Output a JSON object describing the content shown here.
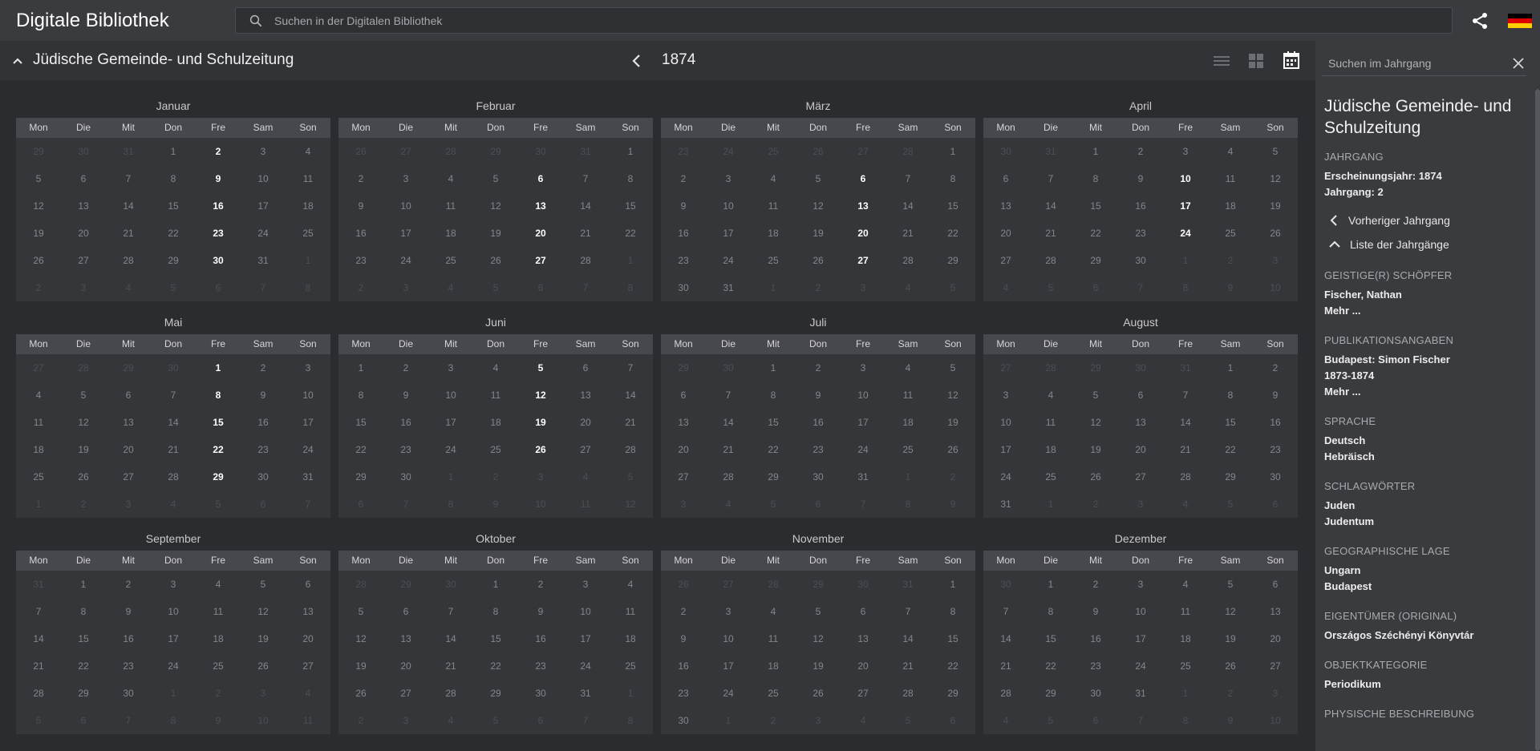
{
  "app": {
    "title": "Digitale Bibliothek",
    "search_placeholder": "Suchen in der Digitalen Bibliothek"
  },
  "header": {
    "issue_title": "Jüdische Gemeinde- und Schulzeitung",
    "year": "1874"
  },
  "weekdays": [
    "Mon",
    "Die",
    "Mit",
    "Don",
    "Fre",
    "Sam",
    "Son"
  ],
  "months": [
    {
      "name": "Januar",
      "lead": [
        29,
        30,
        31
      ],
      "days": 31,
      "issues": [
        2,
        9,
        16,
        23,
        30
      ]
    },
    {
      "name": "Februar",
      "lead": [
        26,
        27,
        28,
        29,
        30,
        31
      ],
      "days": 28,
      "issues": [
        6,
        13,
        20,
        27
      ]
    },
    {
      "name": "März",
      "lead": [
        23,
        24,
        25,
        26,
        27,
        28
      ],
      "days": 31,
      "issues": [
        6,
        13,
        20,
        27
      ]
    },
    {
      "name": "April",
      "lead": [
        30,
        31
      ],
      "days": 30,
      "issues": [
        10,
        17,
        24
      ]
    },
    {
      "name": "Mai",
      "lead": [
        27,
        28,
        29,
        30
      ],
      "days": 31,
      "issues": [
        1,
        8,
        15,
        22,
        29
      ]
    },
    {
      "name": "Juni",
      "lead": [],
      "days": 30,
      "issues": [
        5,
        12,
        19,
        26
      ]
    },
    {
      "name": "Juli",
      "lead": [
        29,
        30
      ],
      "days": 31,
      "issues": []
    },
    {
      "name": "August",
      "lead": [
        27,
        28,
        29,
        30,
        31
      ],
      "days": 31,
      "issues": []
    },
    {
      "name": "September",
      "lead": [
        31
      ],
      "days": 30,
      "issues": []
    },
    {
      "name": "Oktober",
      "lead": [
        28,
        29,
        30
      ],
      "days": 31,
      "issues": []
    },
    {
      "name": "November",
      "lead": [
        26,
        27,
        28,
        29,
        30,
        31
      ],
      "days": 30,
      "issues": []
    },
    {
      "name": "Dezember",
      "lead": [
        30
      ],
      "days": 31,
      "issues": []
    }
  ],
  "sidebar": {
    "search_placeholder": "Suchen im Jahrgang",
    "title": "Jüdische Gemeinde- und Schulzeitung",
    "jahrgang_label": "Jahrgang",
    "jahrgang_year": "Erscheinungsjahr: 1874",
    "jahrgang_num": "Jahrgang: 2",
    "prev_link": "Vorheriger Jahrgang",
    "list_link": "Liste der Jahrgänge",
    "creator_label": "Geistige(r) Schöpfer",
    "creator": "Fischer, Nathan",
    "more1": "Mehr ...",
    "pub_label": "Publikationsangaben",
    "pub_place": "Budapest: Simon Fischer",
    "pub_years": "1873-1874",
    "more2": "Mehr ...",
    "lang_label": "Sprache",
    "lang1": "Deutsch",
    "lang2": "Hebräisch",
    "kw_label": "Schlagwörter",
    "kw1": "Juden",
    "kw2": "Judentum",
    "geo_label": "Geographische Lage",
    "geo1": "Ungarn",
    "geo2": "Budapest",
    "owner_label": "Eigentümer (Original)",
    "owner": "Országos Széchényi Könyvtár",
    "cat_label": "Objektkategorie",
    "cat": "Periodikum",
    "phys_label": "Physische Beschreibung"
  },
  "colors": {
    "background": "#2b2c30",
    "topbar": "#3a3b3f",
    "accent_text": "#ffffff"
  }
}
